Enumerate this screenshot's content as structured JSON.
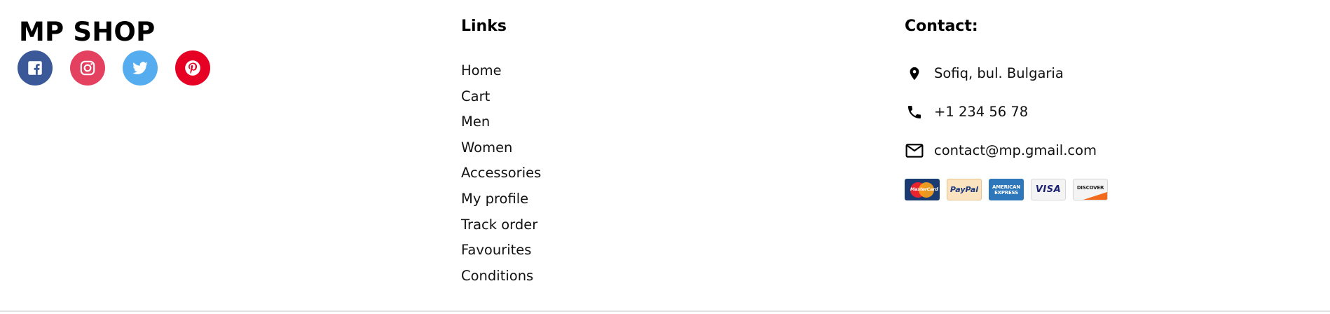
{
  "brand": {
    "name": "MP SHOP"
  },
  "socials": [
    {
      "name": "facebook",
      "icon": "facebook-icon",
      "color": "#3b5998"
    },
    {
      "name": "instagram",
      "icon": "instagram-icon",
      "color": "#e4405f"
    },
    {
      "name": "twitter",
      "icon": "twitter-icon",
      "color": "#55acee"
    },
    {
      "name": "pinterest",
      "icon": "pinterest-icon",
      "color": "#e60023"
    }
  ],
  "links": {
    "title": "Links",
    "items": [
      {
        "label": "Home"
      },
      {
        "label": "Cart"
      },
      {
        "label": "Men"
      },
      {
        "label": "Women"
      },
      {
        "label": "Accessories"
      },
      {
        "label": "My profile"
      },
      {
        "label": "Track order"
      },
      {
        "label": "Favourites"
      },
      {
        "label": "Conditions"
      }
    ]
  },
  "contact": {
    "title": "Contact:",
    "address": {
      "icon": "location-pin-icon",
      "text": "Sofiq, bul. Bulgaria"
    },
    "phone": {
      "icon": "phone-icon",
      "text": "+1 234 56 78"
    },
    "email": {
      "icon": "mail-icon",
      "text": "contact@mp.gmail.com"
    }
  },
  "payments": {
    "mastercard": {
      "label": "MasterCard",
      "icon": "mastercard-icon"
    },
    "paypal": {
      "label": "PayPal",
      "icon": "paypal-icon"
    },
    "amex": {
      "label": "AMERICAN EXPRESS",
      "icon": "amex-icon"
    },
    "visa": {
      "label": "VISA",
      "icon": "visa-icon"
    },
    "discover": {
      "label": "DISCOVER",
      "icon": "discover-icon"
    }
  }
}
